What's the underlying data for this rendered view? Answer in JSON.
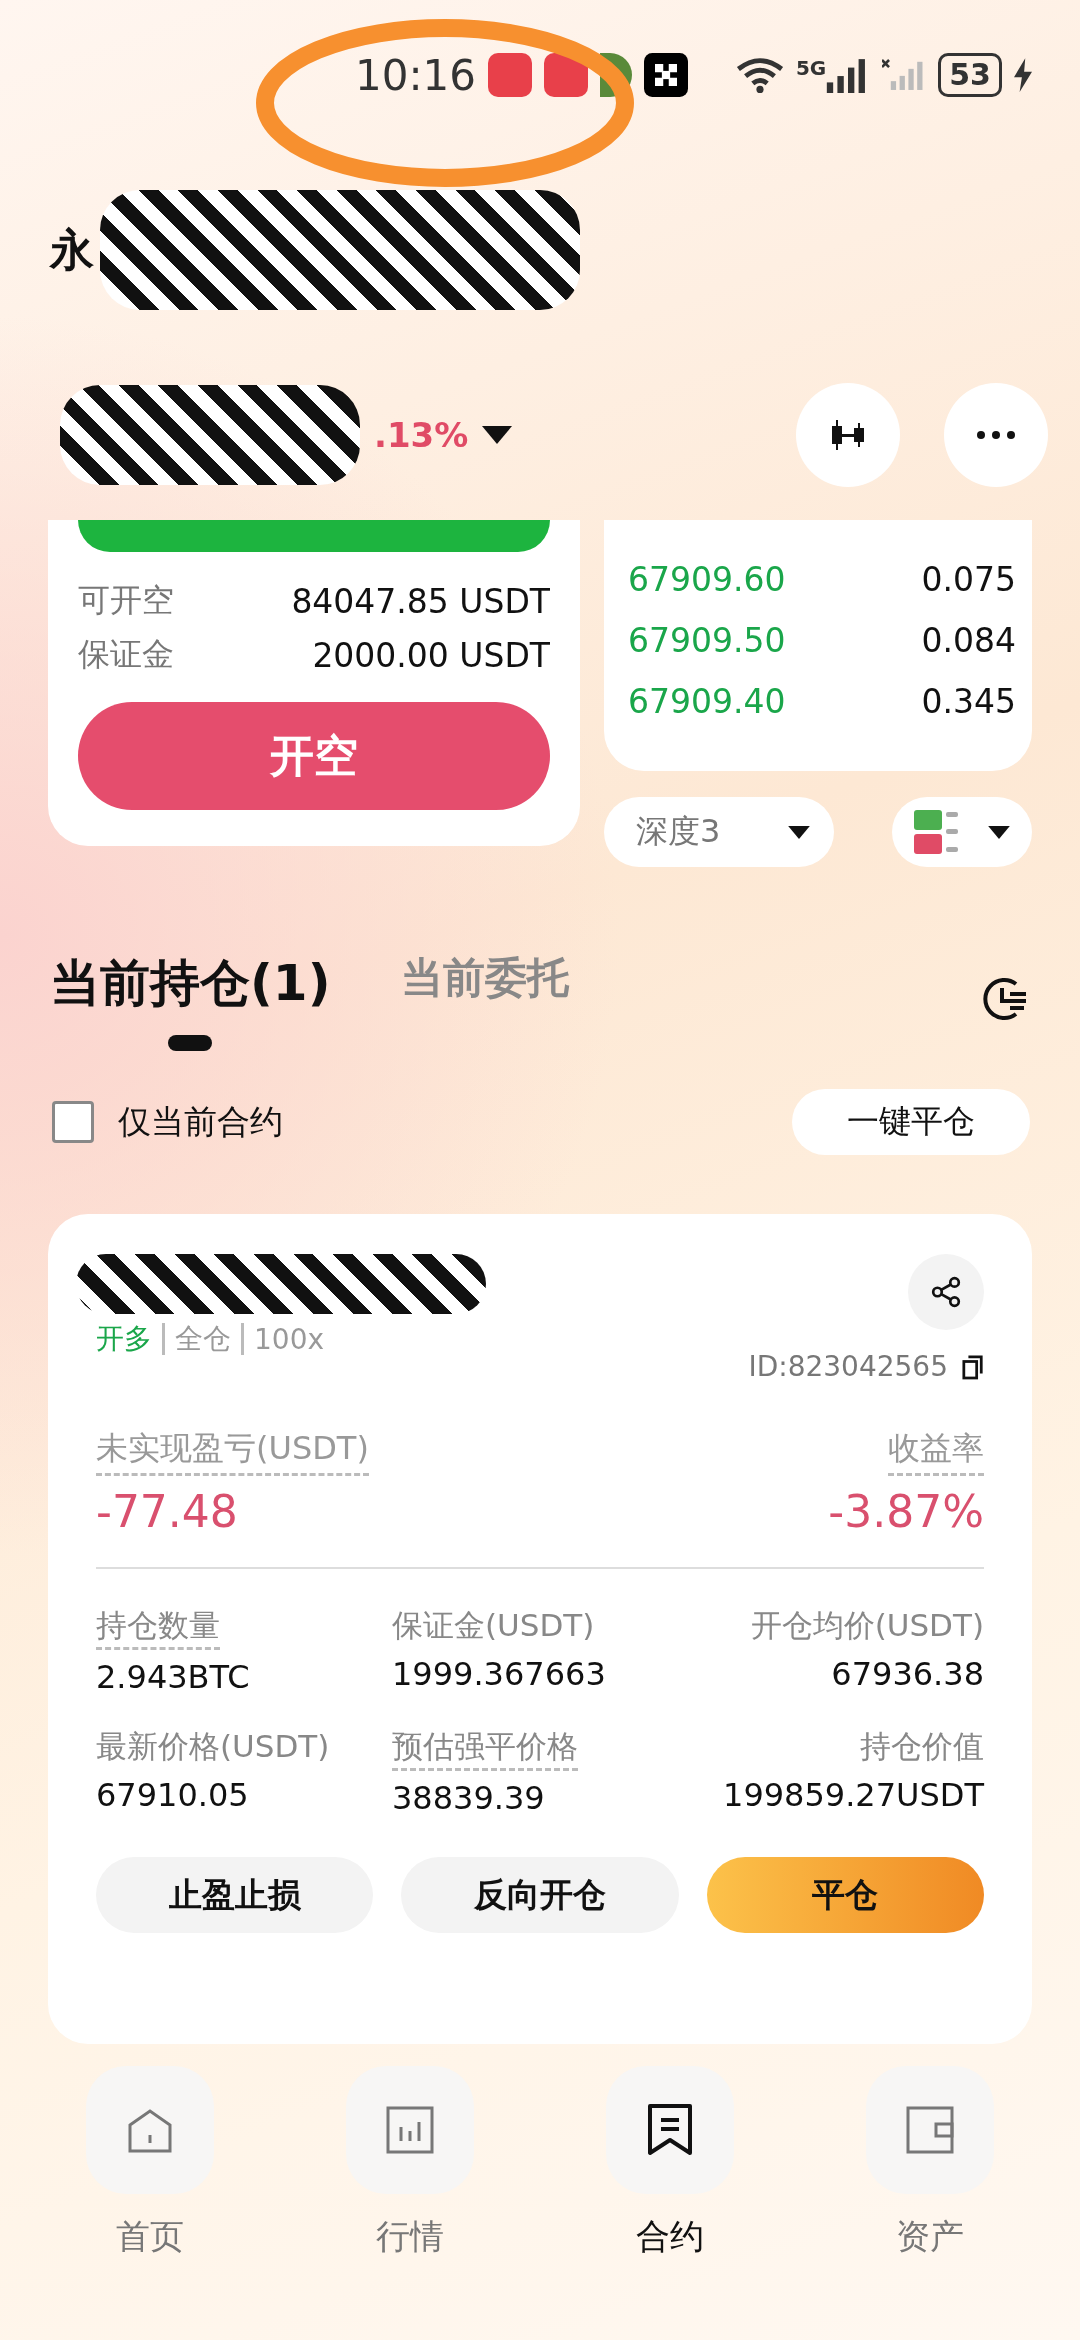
{
  "status_bar": {
    "time": "10:16",
    "battery": "53",
    "network": "5G"
  },
  "header": {
    "tabs": [
      {
        "label": "永",
        "selected": true
      }
    ]
  },
  "ticker": {
    "change": ".13%"
  },
  "order_panel": {
    "rows": [
      {
        "label": "可开空",
        "value": "84047.85 USDT"
      },
      {
        "label": "保证金",
        "value": "2000.00 USDT"
      }
    ],
    "sell_button": "开空"
  },
  "order_book": {
    "rows": [
      {
        "price": "67909.60",
        "amount": "0.075"
      },
      {
        "price": "67909.50",
        "amount": "0.084"
      },
      {
        "price": "67909.40",
        "amount": "0.345"
      }
    ],
    "depth_selector": "深度3"
  },
  "position_tabs": [
    {
      "label": "当前持仓(1)",
      "selected": true
    },
    {
      "label": "当前委托",
      "selected": false
    }
  ],
  "filter": {
    "label": "仅当前合约",
    "checked": false,
    "close_all_button": "一键平仓"
  },
  "position": {
    "tags": [
      {
        "label": "开多",
        "kind": "side"
      },
      {
        "label": "全仓",
        "kind": "plain"
      },
      {
        "label": "100x",
        "kind": "plain"
      }
    ],
    "id": "ID:823042565",
    "pnl": {
      "label": "未实现盈亏(USDT)",
      "value": "-77.48"
    },
    "roe": {
      "label": "收益率",
      "value": "-3.87%"
    },
    "fields": [
      {
        "label": "持仓数量",
        "value": "2.943BTC",
        "dashed": true
      },
      {
        "label": "保证金(USDT)",
        "value": "1999.367663",
        "dashed": false
      },
      {
        "label": "开仓均价(USDT)",
        "value": "67936.38",
        "dashed": false
      },
      {
        "label": "最新价格(USDT)",
        "value": "67910.05",
        "dashed": false
      },
      {
        "label": "预估强平价格",
        "value": "38839.39",
        "dashed": true
      },
      {
        "label": "持仓价值",
        "value": "199859.27USDT",
        "dashed": false
      }
    ],
    "buttons": [
      {
        "label": "止盈止损",
        "kind": "plain"
      },
      {
        "label": "反向开仓",
        "kind": "plain"
      },
      {
        "label": "平仓",
        "kind": "primary"
      }
    ]
  },
  "bottom_nav": [
    {
      "label": "首页",
      "selected": false
    },
    {
      "label": "行情",
      "selected": false
    },
    {
      "label": "合约",
      "selected": true
    },
    {
      "label": "资产",
      "selected": false
    }
  ]
}
